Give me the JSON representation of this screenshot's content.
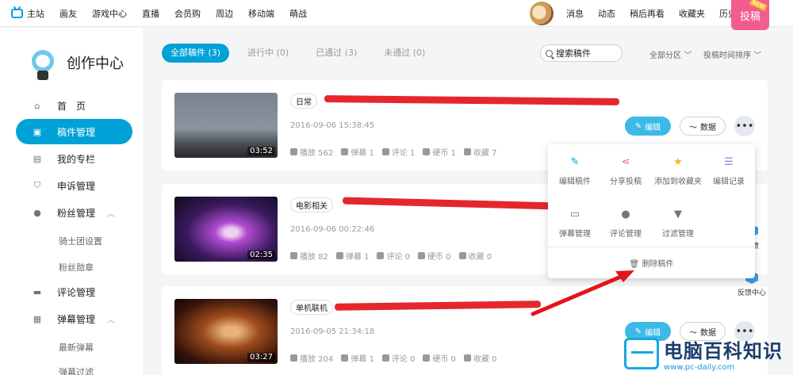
{
  "top_nav": {
    "home": "主站",
    "items": [
      "画友",
      "游戏中心",
      "直播",
      "会员购",
      "周边",
      "移动端",
      "萌战"
    ],
    "right_items": [
      "消息",
      "动态",
      "稍后再看",
      "收藏夹",
      "历史"
    ],
    "upload": "投稿",
    "new_tag": "NEW"
  },
  "sidebar": {
    "title": "创作中心",
    "items": [
      {
        "label": "首　页",
        "icon": "home-icon"
      },
      {
        "label": "稿件管理",
        "icon": "video-icon"
      },
      {
        "label": "我的专栏",
        "icon": "article-icon"
      },
      {
        "label": "申诉管理",
        "icon": "shield-icon"
      },
      {
        "label": "粉丝管理",
        "icon": "fans-icon"
      },
      {
        "label": "评论管理",
        "icon": "comment-icon"
      },
      {
        "label": "弹幕管理",
        "icon": "danmaku-icon"
      }
    ],
    "fans_sub": [
      "骑士团设置",
      "粉丝勋章"
    ],
    "danmaku_sub": [
      "最新弹幕",
      "弹幕过滤"
    ]
  },
  "tabs": [
    "全部稿件 (3)",
    "进行中 (0)",
    "已通过 (3)",
    "未通过 (0)"
  ],
  "search_placeholder": "搜索稿件",
  "filter_zone": "全部分区",
  "filter_sort": "投稿时间排序",
  "buttons": {
    "edit": "编辑",
    "data": "数据",
    "more": "•••"
  },
  "videos": [
    {
      "tag": "日常",
      "date": "2016-09-06 15:38:45",
      "duration": "03:52",
      "plays": "播放 562",
      "danmaku": "弹幕 1",
      "comments": "评论 1",
      "coins": "硬币 1",
      "favorites": "收藏 7"
    },
    {
      "tag": "电影相关",
      "date": "2016-09-06 00:22:46",
      "duration": "02:35",
      "plays": "播放 82",
      "danmaku": "弹幕 1",
      "comments": "评论 0",
      "coins": "硬币 0",
      "favorites": "收藏 0"
    },
    {
      "tag": "单机联机",
      "date": "2016-09-05 21:34:18",
      "duration": "03:27",
      "plays": "播放 204",
      "danmaku": "弹幕 1",
      "comments": "评论 0",
      "coins": "硬币 0",
      "favorites": "收藏 0"
    }
  ],
  "popup": {
    "row1": [
      "编辑稿件",
      "分享投稿",
      "添加到收藏夹",
      "编辑记录"
    ],
    "row2": [
      "弹幕管理",
      "评论管理",
      "过滤管理"
    ],
    "delete": "删除稿件"
  },
  "right_float": {
    "item1": "反馈",
    "item2": "反馈中心"
  },
  "watermark": {
    "title": "电脑百科知识",
    "url": "www.pc-daily.com"
  },
  "colors": {
    "accent": "#00a1d6",
    "upload": "#f25d8e",
    "annotation": "#e4141b"
  }
}
